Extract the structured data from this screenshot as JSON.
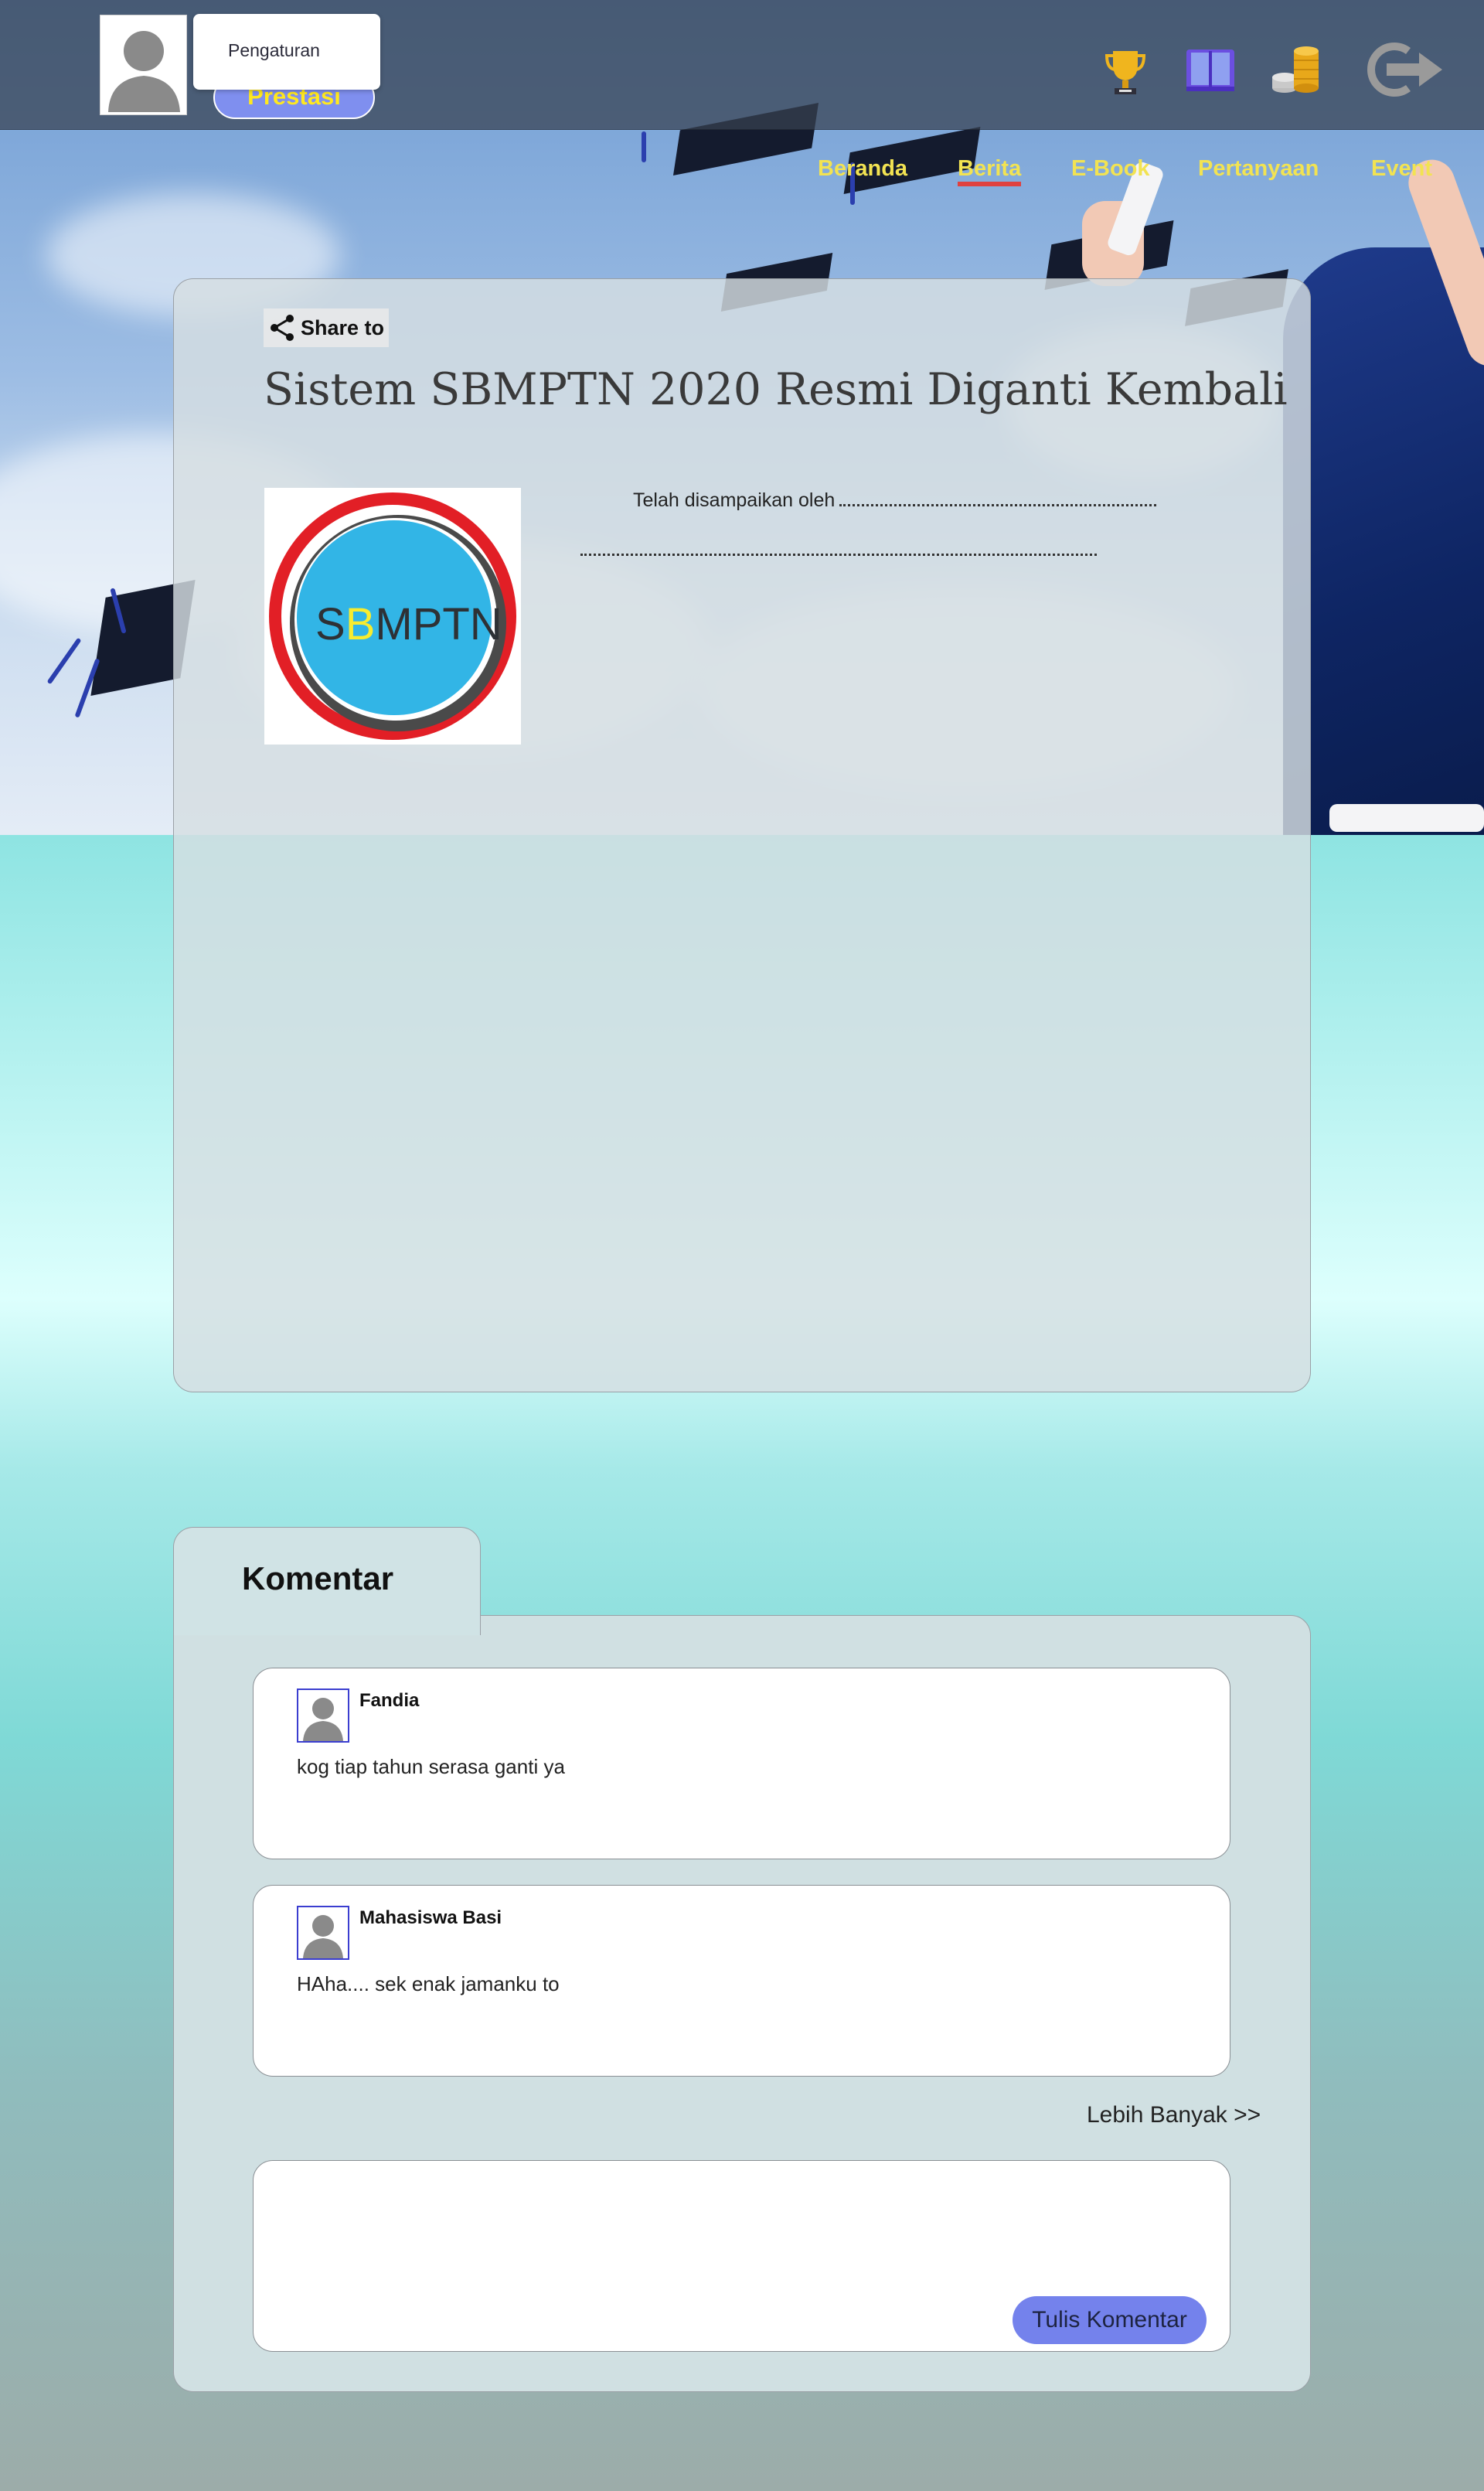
{
  "header": {
    "settings_label": "Pengaturan",
    "prestasi_label": "Prestasi",
    "icons": [
      "trophy-icon",
      "book-icon",
      "coins-icon",
      "logout-icon"
    ]
  },
  "nav": {
    "items": [
      {
        "label": "Beranda"
      },
      {
        "label": "Berita"
      },
      {
        "label": "E-Book"
      },
      {
        "label": "Pertanyaan"
      },
      {
        "label": "Event"
      }
    ],
    "active": "Berita"
  },
  "article": {
    "share_label": "Share to",
    "title": "Sistem SBMPTN 2020 Resmi Diganti Kembali",
    "image_label_s": "S",
    "image_label_b": "B",
    "image_label_rest": "MPTN",
    "body_text": "Telah disampaikan oleh"
  },
  "comments": {
    "tab_label": "Komentar",
    "items": [
      {
        "name": "Fandia",
        "text": "kog tiap tahun serasa ganti ya"
      },
      {
        "name": "Mahasiswa Basi",
        "text": "HAha.... sek enak jamanku to"
      }
    ],
    "more_label": "Lebih Banyak >>",
    "submit_label": "Tulis Komentar"
  },
  "colors": {
    "nav_text": "#f2e352",
    "nav_active_underline": "#e0413f",
    "prestasi_bg": "#7f8fef",
    "button_bg": "#7482ec",
    "avatar_border": "#3b3ed0"
  }
}
